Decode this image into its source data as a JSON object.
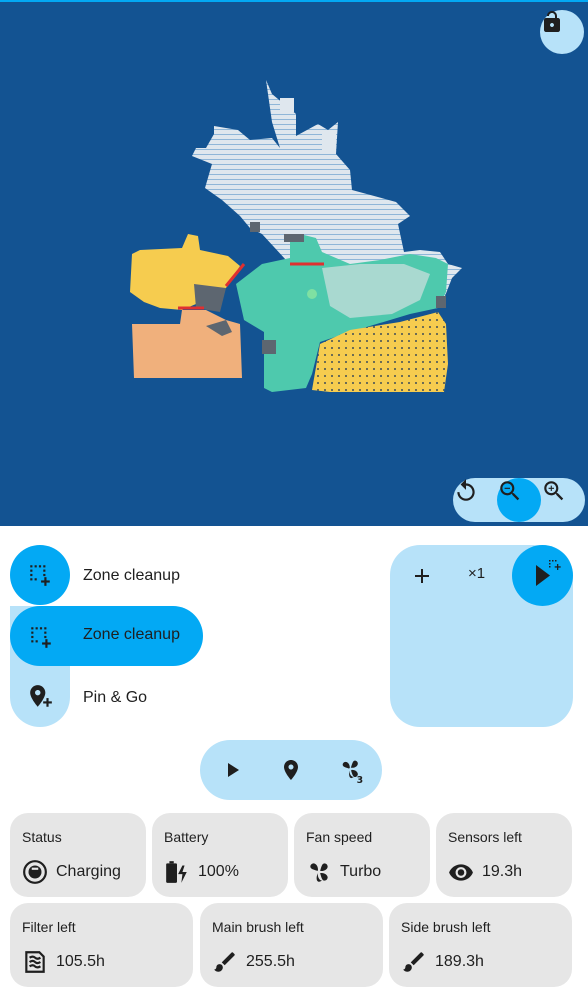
{
  "colors": {
    "accent": "#03a9f4",
    "accent_light": "#b7e2f9",
    "map_background": "#135392",
    "tile_background": "#e6e6e6",
    "room_yellow": "#f6cc4f",
    "room_orange": "#f0b07c",
    "room_teal": "#4ec9ad",
    "room_light": "#dfe7ee",
    "obstacle": "#5d6670",
    "virtual_wall": "#e03030"
  },
  "map": {
    "lock_icon": "lock-open-icon",
    "zoom_controls": [
      "rotate-icon",
      "zoom-out-icon",
      "zoom-in-icon"
    ]
  },
  "modes": {
    "current": {
      "icon": "select-zone-icon",
      "label": "Zone cleanup"
    },
    "options": [
      {
        "icon": "select-zone-icon",
        "label": "Zone cleanup"
      },
      {
        "icon": "map-marker-plus-icon",
        "label": "Pin & Go"
      }
    ]
  },
  "repeat": {
    "add_icon": "plus-icon",
    "count": "×1",
    "start_icon": "play-zone-icon"
  },
  "actions": [
    "play-icon",
    "map-marker-icon",
    "fan-speed-3-icon"
  ],
  "tiles": [
    {
      "title": "Status",
      "icon": "robot-vacuum-icon",
      "value": "Charging"
    },
    {
      "title": "Battery",
      "icon": "battery-charging-icon",
      "value": "100%"
    },
    {
      "title": "Fan speed",
      "icon": "fan-icon",
      "value": "Turbo"
    },
    {
      "title": "Sensors left",
      "icon": "eye-icon",
      "value": "19.3h"
    },
    {
      "title": "Filter left",
      "icon": "air-filter-icon",
      "value": "105.5h"
    },
    {
      "title": "Main brush left",
      "icon": "brush-icon",
      "value": "255.5h"
    },
    {
      "title": "Side brush left",
      "icon": "brush-icon",
      "value": "189.3h"
    }
  ]
}
